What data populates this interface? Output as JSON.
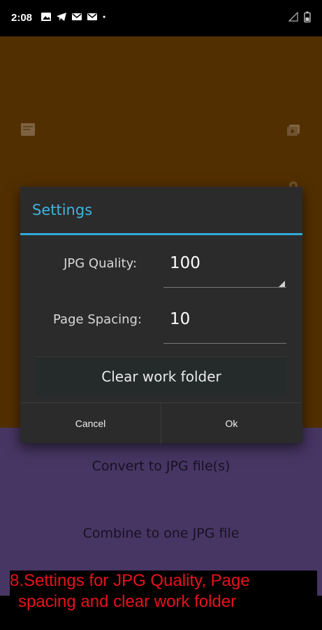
{
  "status_bar": {
    "time": "2:08",
    "icons": [
      "image-icon",
      "telegram-icon",
      "gmail-icon",
      "gmail-icon",
      "dot-icon"
    ],
    "right_icons": [
      "signal-icon",
      "battery-icon"
    ]
  },
  "app": {
    "actions": {
      "convert_label": "Convert to JPG file(s)",
      "combine_label": "Combine to one JPG file"
    },
    "colors": {
      "top_bg": "#5a3302",
      "bottom_bg": "#4e3a6c"
    }
  },
  "dialog": {
    "title": "Settings",
    "jpg_quality": {
      "label": "JPG Quality:",
      "value": "100"
    },
    "page_spacing": {
      "label": "Page Spacing:",
      "value": "10"
    },
    "clear_button_label": "Clear work folder",
    "cancel_label": "Cancel",
    "ok_label": "Ok",
    "accent_color": "#33aad8"
  },
  "caption": {
    "line1": "8.Settings for JPG Quality, Page",
    "line2": "spacing and clear work folder",
    "color": "#e8121b"
  }
}
